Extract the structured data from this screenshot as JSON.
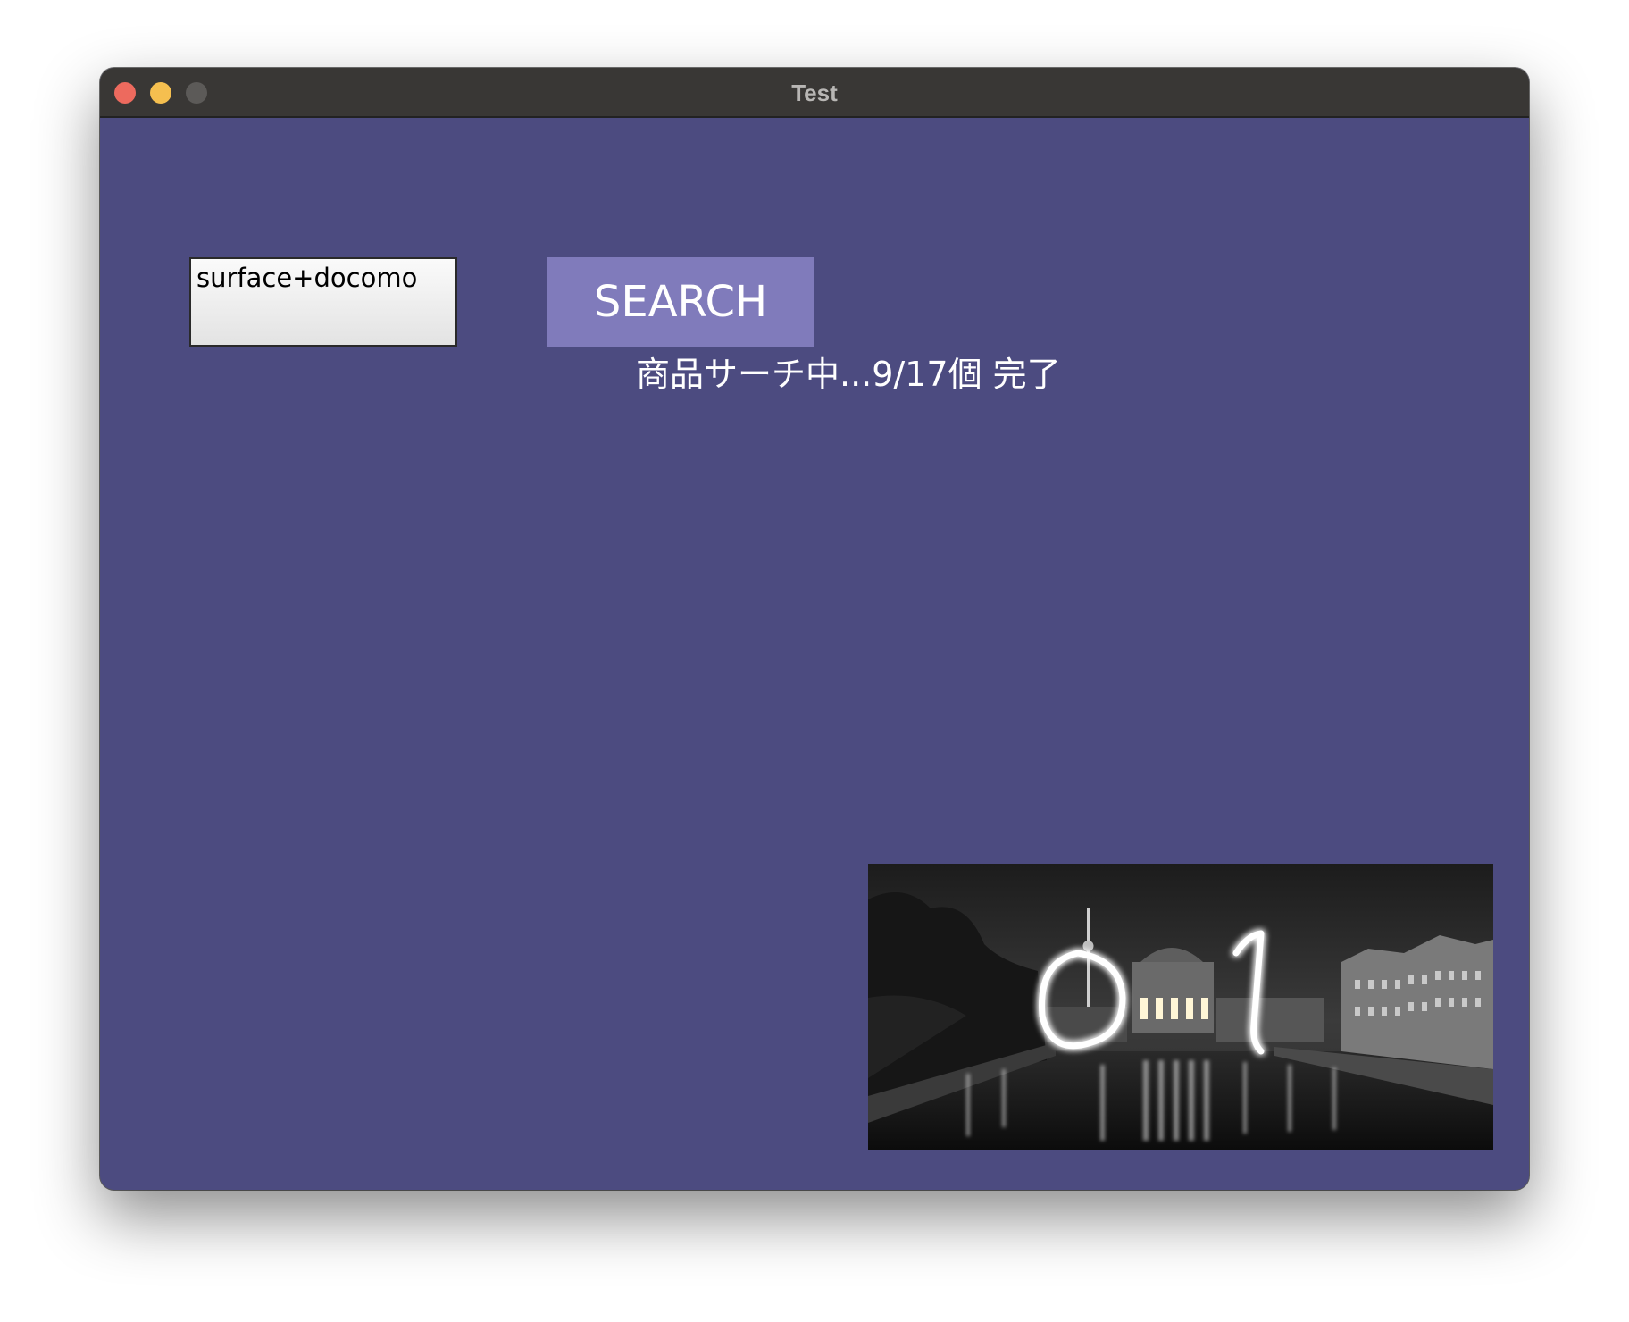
{
  "window": {
    "title": "Test",
    "controls": {
      "close_color": "#ed6a5e",
      "minimize_color": "#f5bf4f",
      "zoom_color": "#5c5a58"
    },
    "background_color": "#4c4b80"
  },
  "search": {
    "value": "surface+docomo",
    "button_label": "SEARCH",
    "button_color": "#807bbb"
  },
  "status": {
    "text": "商品サーチ中...9/17個 完了"
  },
  "photo": {
    "description_icon": "night-city-river-photo",
    "overlay_text": "01"
  }
}
